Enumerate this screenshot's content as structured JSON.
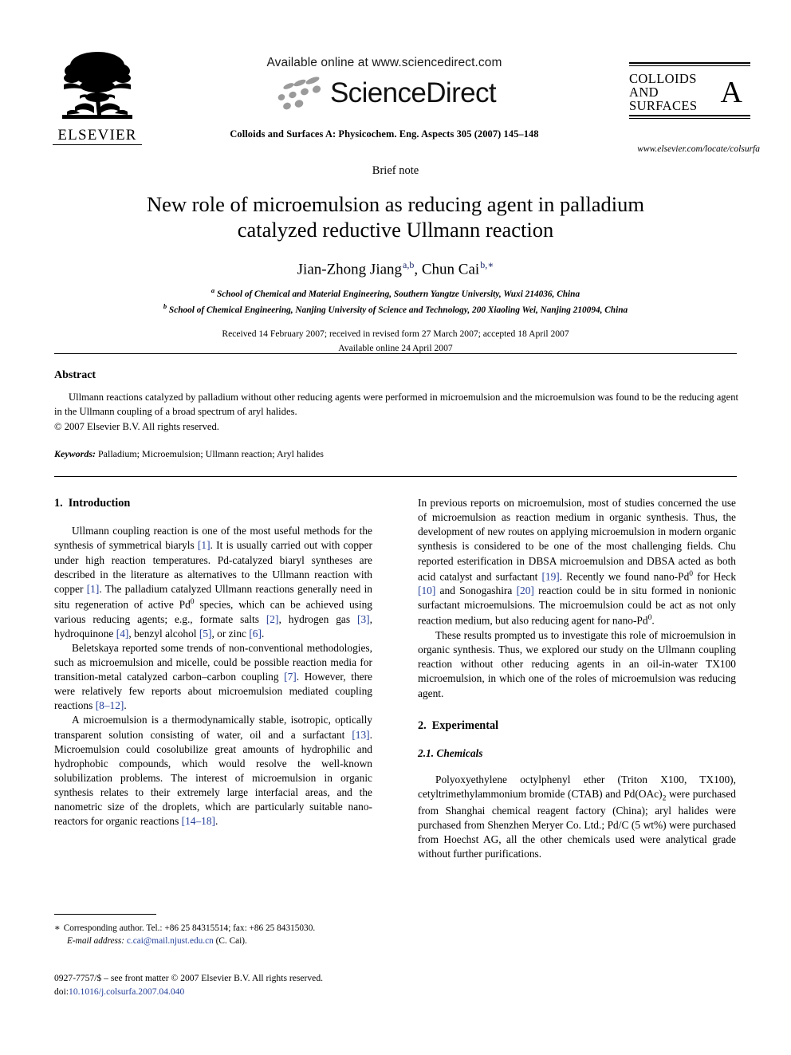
{
  "header": {
    "available_online": "Available online at www.sciencedirect.com",
    "sciencedirect_wordmark": "ScienceDirect",
    "elsevier_wordmark": "ELSEVIER",
    "journal_line": "Colloids and Surfaces A: Physicochem. Eng. Aspects 305 (2007) 145–148",
    "cover_title_line1": "COLLOIDS",
    "cover_title_line2": "AND",
    "cover_title_line3": "SURFACES",
    "cover_series_letter": "A",
    "cover_url": "www.elsevier.com/locate/colsurfa"
  },
  "article": {
    "type_label": "Brief note",
    "title_line1": "New role of microemulsion as reducing agent in palladium",
    "title_line2": "catalyzed reductive Ullmann reaction",
    "authors": [
      {
        "name": "Jian-Zhong Jiang",
        "marks": "a,b",
        "separator": ", "
      },
      {
        "name": "Chun Cai",
        "marks": "b,∗",
        "separator": ""
      }
    ],
    "affiliations": [
      {
        "mark": "a",
        "text": "School of Chemical and Material Engineering, Southern Yangtze University, Wuxi 214036, China"
      },
      {
        "mark": "b",
        "text": "School of Chemical Engineering, Nanjing University of Science and Technology, 200 Xiaoling Wei, Nanjing 210094, China"
      }
    ],
    "received_line": "Received 14 February 2007; received in revised form 27 March 2007; accepted 18 April 2007",
    "available_line": "Available online 24 April 2007"
  },
  "abstract": {
    "heading": "Abstract",
    "body": "Ullmann reactions catalyzed by palladium without other reducing agents were performed in microemulsion and the microemulsion was found to be the reducing agent in the Ullmann coupling of a broad spectrum of aryl halides.",
    "copyright": "© 2007 Elsevier B.V. All rights reserved.",
    "keywords_label": "Keywords:",
    "keywords_value": "Palladium; Microemulsion; Ullmann reaction; Aryl halides"
  },
  "sections": {
    "introduction_heading_number": "1.",
    "introduction_heading_text": "Introduction",
    "experimental_heading_number": "2.",
    "experimental_heading_text": "Experimental",
    "chemicals_heading": "2.1. Chemicals"
  },
  "body": {
    "p1_a": "Ullmann coupling reaction is one of the most useful methods for the synthesis of symmetrical biaryls ",
    "p1_r1": "[1]",
    "p1_b": ". It is usually carried out with copper under high reaction temperatures. Pd-catalyzed biaryl syntheses are described in the literature as alternatives to the Ullmann reaction with copper ",
    "p1_r2": "[1]",
    "p1_c": ". The palladium catalyzed Ullmann reactions generally need in situ regeneration of active Pd",
    "p1_sup1": "0",
    "p1_d": " species, which can be achieved using various reducing agents; e.g., formate salts ",
    "p1_r3": "[2]",
    "p1_e": ", hydrogen gas ",
    "p1_r4": "[3]",
    "p1_f": ", hydroquinone ",
    "p1_r5": "[4]",
    "p1_g": ", benzyl alcohol ",
    "p1_r6": "[5]",
    "p1_h": ", or zinc ",
    "p1_r7": "[6]",
    "p1_i": ".",
    "p2_a": "Beletskaya reported some trends of non-conventional methodologies, such as microemulsion and micelle, could be possible reaction media for transition-metal catalyzed carbon–carbon coupling ",
    "p2_r1": "[7]",
    "p2_b": ". However, there were relatively few reports about microemulsion mediated coupling reactions ",
    "p2_r2": "[8–12]",
    "p2_c": ".",
    "p3_a": "A microemulsion is a thermodynamically stable, isotropic, optically transparent solution consisting of water, oil and a surfactant ",
    "p3_r1": "[13]",
    "p3_b": ". Microemulsion could cosolubilize great amounts of hydrophilic and hydrophobic compounds, which would resolve the well-known solubilization problems. The interest of microemulsion in organic synthesis relates to their extremely large interfacial areas, and the nanometric size of the droplets, which are particularly suitable nano-reactors for organic reactions ",
    "p3_r2": "[14–18]",
    "p3_c": ".",
    "p4_a": "In previous reports on microemulsion, most of studies concerned the use of microemulsion as reaction medium in organic synthesis. Thus, the development of new routes on applying microemulsion in modern organic synthesis is considered to be one of the most challenging fields. Chu reported esterification in DBSA microemulsion and DBSA acted as both acid catalyst and surfactant ",
    "p4_r1": "[19]",
    "p4_b": ". Recently we found nano-Pd",
    "p4_sup1": "0",
    "p4_c": " for Heck ",
    "p4_r2": "[10]",
    "p4_d": " and Sonogashira ",
    "p4_r3": "[20]",
    "p4_e": " reaction could be in situ formed in nonionic surfactant microemulsions. The microemulsion could be act as not only reaction medium, but also reducing agent for nano-Pd",
    "p4_sup2": "0",
    "p4_f": ".",
    "p5": "These results prompted us to investigate this role of microemulsion in organic synthesis. Thus, we explored our study on the Ullmann coupling reaction without other reducing agents in an oil-in-water TX100 microemulsion, in which one of the roles of microemulsion was reducing agent.",
    "p6_a": "Polyoxyethylene octylphenyl ether (Triton X100, TX100), cetyltrimethylammonium bromide (CTAB) and Pd(OAc)",
    "p6_sub1": "2",
    "p6_b": " were purchased from Shanghai chemical reagent factory (China); aryl halides were purchased from Shenzhen Meryer Co. Ltd.; Pd/C (5 wt%) were purchased from Hoechst AG, all the other chemicals used were analytical grade without further purifications."
  },
  "footnote": {
    "star": "∗",
    "corresponding": "Corresponding author. Tel.: +86 25 84315514; fax: +86 25 84315030.",
    "email_label": "E-mail address:",
    "email": "c.cai@mail.njust.edu.cn",
    "email_suffix": "(C. Cai)."
  },
  "footer": {
    "issn_line": "0927-7757/$ – see front matter © 2007 Elsevier B.V. All rights reserved.",
    "doi_label": "doi:",
    "doi_value": "10.1016/j.colsurfa.2007.04.040"
  },
  "colors": {
    "link": "#26409a",
    "author_mark": "#1c2a6b",
    "logo_gray": "#9a9a9a"
  }
}
